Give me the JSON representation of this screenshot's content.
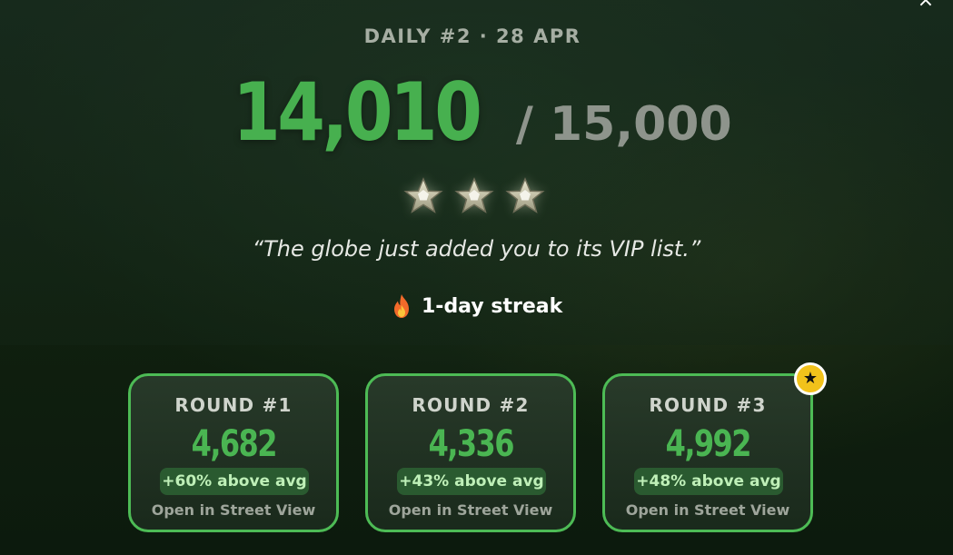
{
  "header": {
    "daily_label": "DAILY #2 · 28 APR",
    "close_label": "×"
  },
  "score": {
    "value": "14,010",
    "max": "/ 15,000"
  },
  "rating": {
    "stars_earned": 3,
    "stars_total": 3,
    "icon": "star-icon"
  },
  "quote": "“The globe just added you to its VIP list.”",
  "streak": {
    "icon": "fire-icon",
    "label": "1-day streak"
  },
  "rounds": [
    {
      "title": "ROUND #1",
      "score": "4,682",
      "delta": "+60% above avg",
      "link": "Open in Street View",
      "best": false
    },
    {
      "title": "ROUND #2",
      "score": "4,336",
      "delta": "+43% above avg",
      "link": "Open in Street View",
      "best": false
    },
    {
      "title": "ROUND #3",
      "score": "4,992",
      "delta": "+48% above avg",
      "link": "Open in Street View",
      "best": true,
      "best_badge": "★"
    }
  ],
  "colors": {
    "accent_green": "#47b04f",
    "card_border": "#4dbb55",
    "badge_bg": "#2a5a30",
    "best_badge": "#f2c21b"
  }
}
